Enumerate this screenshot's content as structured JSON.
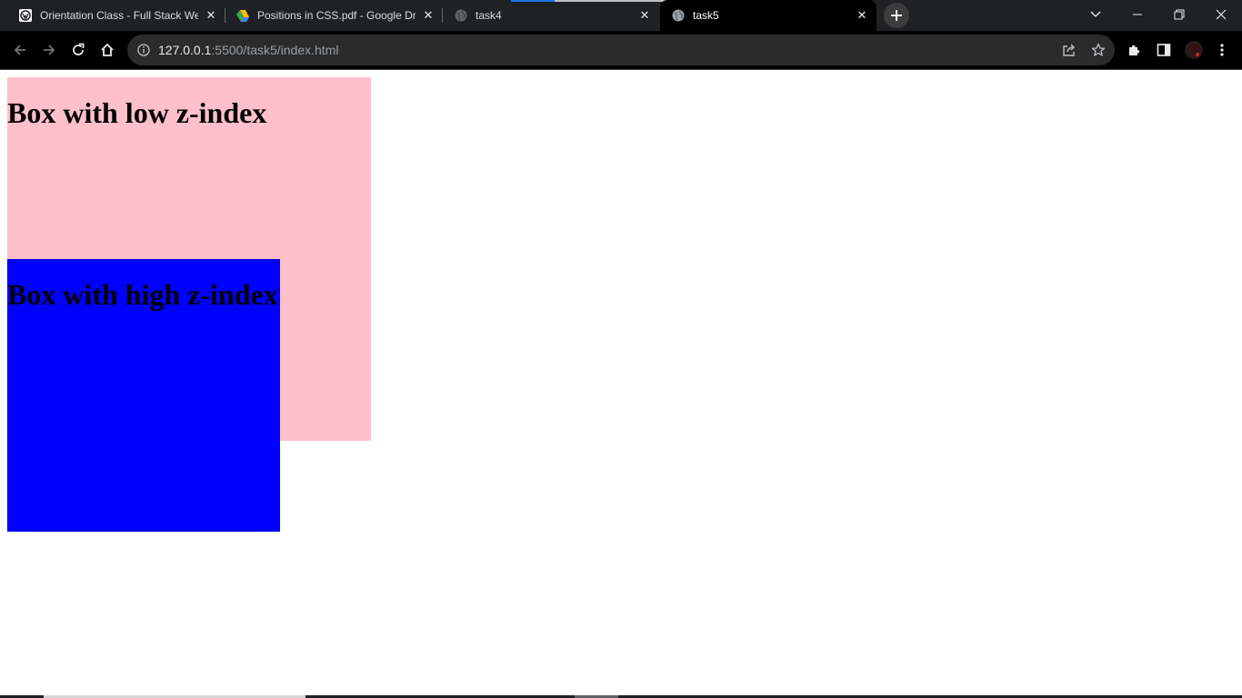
{
  "browser": {
    "tabs": [
      {
        "title": "Orientation Class - Full Stack We",
        "favicon": "wordpress-icon",
        "active": false
      },
      {
        "title": "Positions in CSS.pdf - Google Dr",
        "favicon": "google-drive-icon",
        "active": false
      },
      {
        "title": "task4",
        "favicon": "globe-icon",
        "active": false
      },
      {
        "title": "task5",
        "favicon": "globe-icon",
        "active": true
      }
    ],
    "close_glyph": "✕",
    "address": {
      "host": "127.0.0.1",
      "path": ":5500/task5/index.html"
    },
    "colors": {
      "tabstrip": "#202124",
      "toolbar": "#000000",
      "omnibox": "#2b2b2b",
      "loading_accent": "#1a73e8"
    }
  },
  "page": {
    "low_box": {
      "heading": "Box with low z-index",
      "color": "#ffc0cb"
    },
    "high_box": {
      "heading": "Box with high z-index",
      "color": "#0000ff"
    }
  }
}
